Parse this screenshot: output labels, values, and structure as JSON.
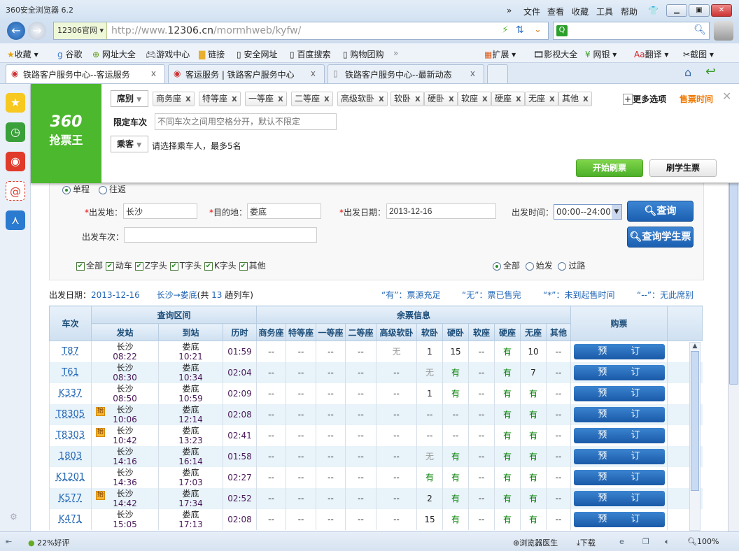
{
  "browser": {
    "title": "360安全浏览器 6.2",
    "menu": [
      "文件",
      "查看",
      "收藏",
      "工具",
      "帮助"
    ],
    "chevron": "»",
    "addr_badge": "12306官网",
    "url_prefix": "http://www.",
    "url_host": "12306.cn",
    "url_path": "/mormhweb/kyfw/",
    "bookmarks": [
      "收藏",
      "谷歌",
      "网址大全",
      "游戏中心",
      "链接",
      "安全网址",
      "百度搜索",
      "购物团购"
    ],
    "tools": [
      "扩展",
      "影视大全",
      "网银",
      "翻译",
      "截图"
    ],
    "tabs": [
      {
        "label": "铁路客户服务中心--客运服务",
        "active": true
      },
      {
        "label": "客运服务 | 铁路客户服务中心",
        "active": false
      },
      {
        "label": "铁路客户服务中心--最新动态",
        "active": false
      }
    ],
    "status": {
      "rating": "22%好评",
      "doctor": "浏览器医生",
      "download": "下载",
      "zoom": "100%"
    }
  },
  "panel": {
    "logo_top": "360",
    "logo_bottom": "抢票王",
    "seat_dd": "席别",
    "seats": [
      "商务座",
      "特等座",
      "一等座",
      "二等座",
      "高级软卧",
      "软卧",
      "硬卧",
      "软座",
      "硬座",
      "无座",
      "其他"
    ],
    "more": "更多选项",
    "sale_time": "售票时间",
    "train_limit_label": "限定车次",
    "train_limit_placeholder": "不同车次之间用空格分开，默认不限定",
    "passenger_dd": "乘客",
    "passenger_hint": "请选择乘车人，最多5名",
    "start_btn": "开始刷票",
    "student_btn": "刷学生票",
    "accent": "#4cb82d"
  },
  "form": {
    "oneway": "单程",
    "roundtrip": "往返",
    "from_label": "出发地：",
    "from": "长沙",
    "to_label": "目的地：",
    "to": "娄底",
    "date_label": "出发日期：",
    "date": "2013-12-16",
    "time_label": "出发时间：",
    "time": "00:00--24:00",
    "train_label": "出发车次：",
    "query_btn": "查询",
    "student_btn": "查询学生票",
    "types": [
      "全部",
      "动车",
      "Z字头",
      "T字头",
      "K字头",
      "其他"
    ],
    "origin_filter": [
      "全部",
      "始发",
      "过路"
    ]
  },
  "summary": {
    "date_label": "出发日期：",
    "date": "2013-12-16",
    "route": "长沙→娄底",
    "count_pre": "(共",
    "count": "13",
    "count_post": "趟列车)"
  },
  "legend": [
    {
      "k": "“有”",
      "v": "：票源充足"
    },
    {
      "k": "“无”",
      "v": "：票已售完"
    },
    {
      "k": "“*”",
      "v": "：未到起售时间"
    },
    {
      "k": "“--”",
      "v": "：无此席别"
    }
  ],
  "table": {
    "h_train": "车次",
    "h_range": "查询区间",
    "h_tickets": "余票信息",
    "h_buy": "购票",
    "h_from": "发站",
    "h_to": "到站",
    "h_dur": "历时",
    "seat_cols": [
      "商务座",
      "特等座",
      "一等座",
      "二等座",
      "高级软卧",
      "软卧",
      "硬卧",
      "软座",
      "硬座",
      "无座",
      "其他"
    ],
    "book_label": "预 订",
    "origin_badge": "始",
    "rows": [
      {
        "train": "T87",
        "origin": false,
        "from": "长沙",
        "dep": "08:22",
        "to": "娄底",
        "arr": "10:21",
        "dur": "01:59",
        "seats": [
          "--",
          "--",
          "--",
          "--",
          "无",
          "1",
          "15",
          "--",
          "有",
          "10",
          "--"
        ]
      },
      {
        "train": "T61",
        "origin": false,
        "from": "长沙",
        "dep": "08:30",
        "to": "娄底",
        "arr": "10:34",
        "dur": "02:04",
        "seats": [
          "--",
          "--",
          "--",
          "--",
          "--",
          "无",
          "有",
          "--",
          "有",
          "7",
          "--"
        ]
      },
      {
        "train": "K337",
        "origin": false,
        "from": "长沙",
        "dep": "08:50",
        "to": "娄底",
        "arr": "10:59",
        "dur": "02:09",
        "seats": [
          "--",
          "--",
          "--",
          "--",
          "--",
          "1",
          "有",
          "--",
          "有",
          "有",
          "--"
        ]
      },
      {
        "train": "T8305",
        "origin": true,
        "from": "长沙",
        "dep": "10:06",
        "to": "娄底",
        "arr": "12:14",
        "dur": "02:08",
        "seats": [
          "--",
          "--",
          "--",
          "--",
          "--",
          "--",
          "--",
          "--",
          "有",
          "有",
          "--"
        ]
      },
      {
        "train": "T8303",
        "origin": true,
        "from": "长沙",
        "dep": "10:42",
        "to": "娄底",
        "arr": "13:23",
        "dur": "02:41",
        "seats": [
          "--",
          "--",
          "--",
          "--",
          "--",
          "--",
          "--",
          "--",
          "有",
          "有",
          "--"
        ]
      },
      {
        "train": "1803",
        "origin": false,
        "from": "长沙",
        "dep": "14:16",
        "to": "娄底",
        "arr": "16:14",
        "dur": "01:58",
        "seats": [
          "--",
          "--",
          "--",
          "--",
          "--",
          "无",
          "有",
          "--",
          "有",
          "有",
          "--"
        ]
      },
      {
        "train": "K1201",
        "origin": false,
        "from": "长沙",
        "dep": "14:36",
        "to": "娄底",
        "arr": "17:03",
        "dur": "02:27",
        "seats": [
          "--",
          "--",
          "--",
          "--",
          "--",
          "有",
          "有",
          "--",
          "有",
          "有",
          "--"
        ]
      },
      {
        "train": "K577",
        "origin": true,
        "from": "长沙",
        "dep": "14:42",
        "to": "娄底",
        "arr": "17:34",
        "dur": "02:52",
        "seats": [
          "--",
          "--",
          "--",
          "--",
          "--",
          "2",
          "有",
          "--",
          "有",
          "有",
          "--"
        ]
      },
      {
        "train": "K471",
        "origin": false,
        "from": "长沙",
        "dep": "15:05",
        "to": "娄底",
        "arr": "17:13",
        "dur": "02:08",
        "seats": [
          "--",
          "--",
          "--",
          "--",
          "--",
          "15",
          "有",
          "--",
          "有",
          "有",
          "--"
        ]
      }
    ]
  }
}
